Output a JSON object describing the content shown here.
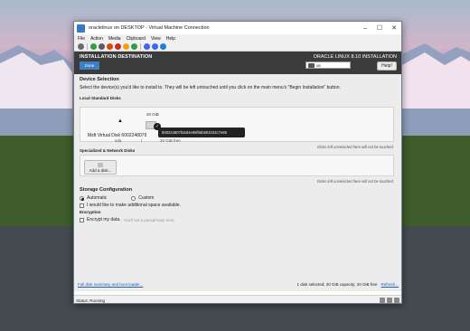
{
  "window": {
    "title": "oraclelinux on DESKTOP - Virtual Machine Connection",
    "menu": [
      "File",
      "Action",
      "Media",
      "Clipboard",
      "View",
      "Help"
    ]
  },
  "header": {
    "title": "INSTALLATION DESTINATION",
    "done_label": "Done",
    "product": "ORACLE LINUX 8.10 INSTALLATION",
    "keyboard": "us",
    "help_label": "Help!"
  },
  "device_selection": {
    "heading": "Device Selection",
    "description": "Select the device(s) you'd like to install to.  They will be left untouched until you click on the main menu's \"Begin Installation\" button.",
    "local_heading": "Local Standard Disks",
    "disk": {
      "size": "20 GiB",
      "name": "Msft Virtual Disk 6002248079",
      "device": "sda",
      "mount": "/",
      "free": "20 GiB free",
      "tooltip": "600224807fa5d4e95fb6b601032c7e85"
    },
    "local_note": "Disks left unselected here will not be touched.",
    "specialized_heading": "Specialized & Network Disks",
    "add_disk_label": "Add a disk...",
    "specialized_note": "Disks left unselected here will not be touched."
  },
  "storage": {
    "heading": "Storage Configuration",
    "automatic_label": "Automatic",
    "custom_label": "Custom",
    "additional_space_label": "I would like to make additional space available.",
    "encryption_heading": "Encryption",
    "encrypt_label": "Encrypt my data.",
    "passphrase_hint": "You'll set a passphrase next."
  },
  "bottom": {
    "summary_link": "Full disk summary and boot loader...",
    "status": "1 disk selected; 20 GiB capacity; 20 GiB free",
    "refresh_link": "Refresh..."
  },
  "statusbar": {
    "text": "Status: Running"
  }
}
